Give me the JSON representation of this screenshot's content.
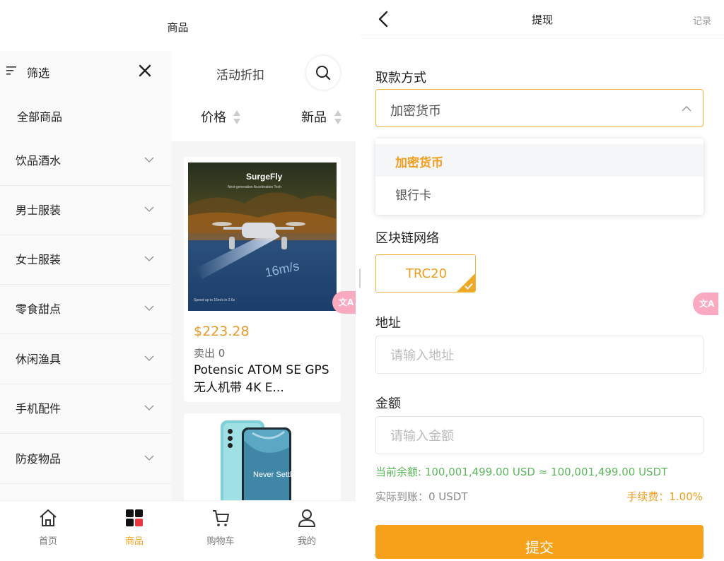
{
  "left": {
    "header": {
      "title": "商品"
    },
    "sidebar": {
      "filter_label": "筛选",
      "all_goods": "全部商品",
      "categories": [
        "饮品酒水",
        "男士服装",
        "女士服装",
        "零食甜点",
        "休闲渔具",
        "手机配件",
        "防疫物品"
      ]
    },
    "toolbar": {
      "promo_label": "活动折扣",
      "sort_price": "价格",
      "sort_new": "新品"
    },
    "products": [
      {
        "price": "$223.28",
        "sold": "卖出 0",
        "name": "Potensic ATOM SE GPS 无人机带 4K E...",
        "image_brand": "SurgeFly",
        "image_subtitle": "Next-generation Acceleration Tech",
        "image_speed": "16m/s",
        "image_caption": "Speed up to 16m/s in 2.6s"
      },
      {
        "image_text": "Never Settle"
      }
    ],
    "tabbar": [
      {
        "label": "首页",
        "icon": "home-icon",
        "active": false
      },
      {
        "label": "商品",
        "icon": "grid-icon",
        "active": true
      },
      {
        "label": "购物车",
        "icon": "cart-icon",
        "active": false
      },
      {
        "label": "我的",
        "icon": "user-icon",
        "active": false
      }
    ],
    "lang_badge": "文A"
  },
  "right": {
    "header": {
      "title": "提现",
      "records": "记录"
    },
    "withdraw_method": {
      "label": "取款方式",
      "selected": "加密货币",
      "options": [
        "加密货币",
        "银行卡"
      ]
    },
    "network": {
      "label": "区块链网络",
      "selected": "TRC20"
    },
    "address": {
      "label": "地址",
      "placeholder": "请输入地址"
    },
    "amount": {
      "label": "金额",
      "placeholder": "请输入金额"
    },
    "balance_text": "当前余额: 100,001,499.00 USD ≈ 100,001,499.00 USDT",
    "actual_text": "实际到账：0 USDT",
    "fee_text": "手续费：1.00%",
    "submit_label": "提交",
    "lang_badge": "文A"
  },
  "colors": {
    "accent": "#f7a11a",
    "balance_green": "#5cb85c",
    "price_orange": "#e69a2b",
    "badge_pink": "#f9a9c0"
  }
}
